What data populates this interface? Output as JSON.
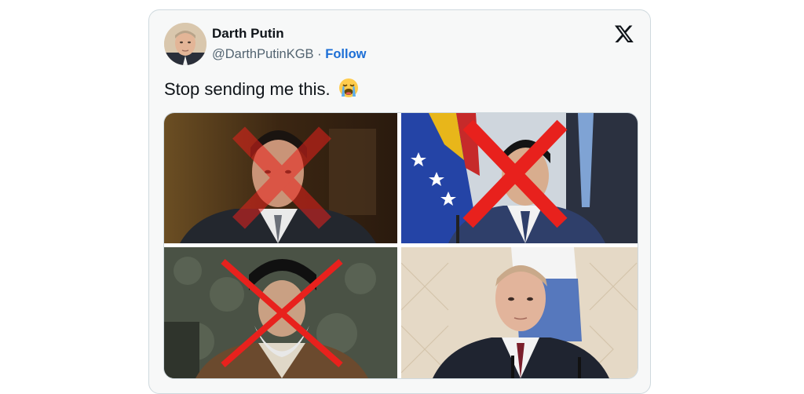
{
  "tweet": {
    "author_name": "Darth Putin",
    "handle": "@DarthPutinKGB",
    "separator": "·",
    "follow_label": "Follow",
    "text": "Stop sending me this.",
    "emoji": "loudly-crying-face",
    "platform_icon": "x-logo-icon"
  },
  "media": {
    "layout": "2x2 grid",
    "images": [
      {
        "position": "top-left",
        "crossed_out": true,
        "cross_style": "faded-red"
      },
      {
        "position": "top-right",
        "crossed_out": true,
        "cross_style": "solid-red"
      },
      {
        "position": "bottom-left",
        "crossed_out": true,
        "cross_style": "solid-red"
      },
      {
        "position": "bottom-right",
        "crossed_out": false
      }
    ]
  },
  "colors": {
    "card_bg": "#f7f8f8",
    "follow": "#1d6fd6",
    "cross_red": "#e8211d"
  }
}
